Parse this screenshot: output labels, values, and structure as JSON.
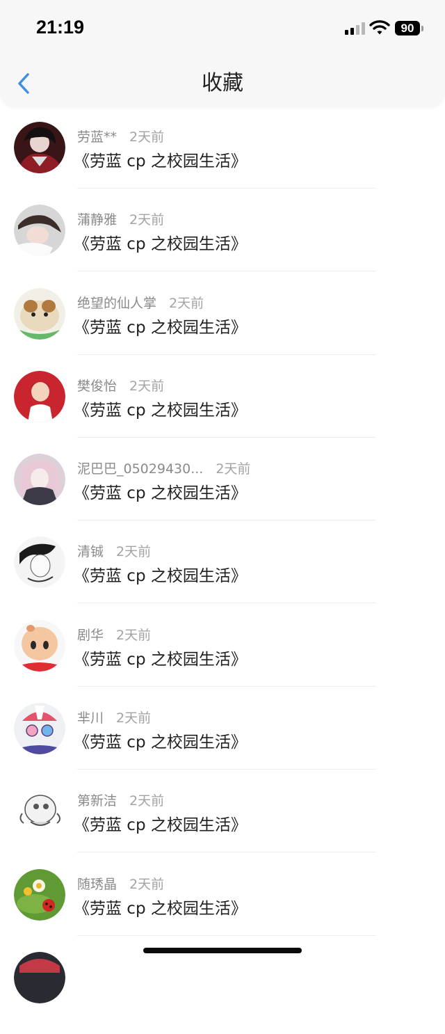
{
  "status": {
    "time": "21:19",
    "battery": "90",
    "icons": [
      "cellular-signal-icon",
      "wifi-icon",
      "battery-icon"
    ]
  },
  "nav": {
    "title": "收藏",
    "back_icon": "chevron-left-icon",
    "accent": "#3d8fe0"
  },
  "items": [
    {
      "name": "劳蓝**",
      "time": "2天前",
      "title": "《劳蓝 cp 之校园生活》"
    },
    {
      "name": "蒲静雅",
      "time": "2天前",
      "title": "《劳蓝 cp 之校园生活》"
    },
    {
      "name": "绝望的仙人掌",
      "time": "2天前",
      "title": "《劳蓝 cp 之校园生活》"
    },
    {
      "name": "樊俊怡",
      "time": "2天前",
      "title": "《劳蓝 cp 之校园生活》"
    },
    {
      "name": "泥巴巴_05029430...",
      "time": "2天前",
      "title": "《劳蓝 cp 之校园生活》"
    },
    {
      "name": "清铖",
      "time": "2天前",
      "title": "《劳蓝 cp 之校园生活》"
    },
    {
      "name": "剧华",
      "time": "2天前",
      "title": "《劳蓝 cp 之校园生活》"
    },
    {
      "name": "芈川",
      "time": "2天前",
      "title": "《劳蓝 cp 之校园生活》"
    },
    {
      "name": "第新洁",
      "time": "2天前",
      "title": "《劳蓝 cp 之校园生活》"
    },
    {
      "name": "随琇晶",
      "time": "2天前",
      "title": "《劳蓝 cp 之校园生活》"
    },
    {
      "name": "",
      "time": "",
      "title": ""
    }
  ]
}
